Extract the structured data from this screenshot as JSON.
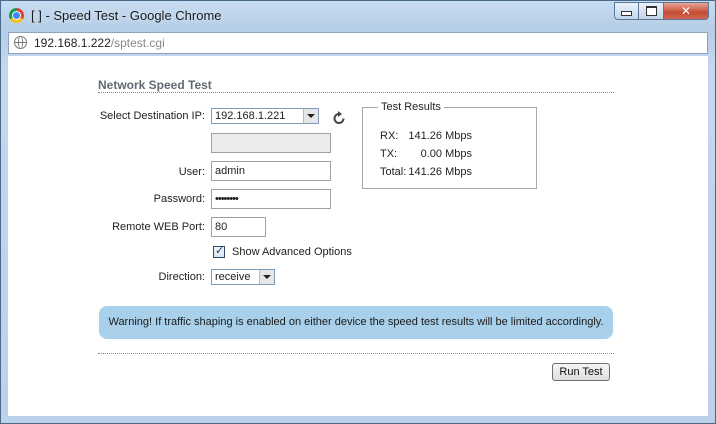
{
  "window": {
    "title": "[ ] - Speed Test - Google Chrome",
    "minimize_icon": "minimize-icon",
    "maximize_icon": "maximize-icon",
    "close_glyph": "✕"
  },
  "address_bar": {
    "host": "192.168.1.222",
    "path": "/sptest.cgi"
  },
  "page": {
    "title": "Network Speed Test",
    "destination": {
      "label": "Select Destination IP:",
      "selected": "192.168.1.221",
      "custom_value": ""
    },
    "user": {
      "label": "User:",
      "value": "admin"
    },
    "password": {
      "label": "Password:",
      "value": "••••••••"
    },
    "remote_port": {
      "label": "Remote WEB Port:",
      "value": "80"
    },
    "advanced": {
      "label": "Show Advanced Options",
      "checked": true
    },
    "direction": {
      "label": "Direction:",
      "selected": "receive"
    },
    "results": {
      "legend": "Test Results",
      "rx_label": "RX:",
      "rx_value": "141.26 Mbps",
      "tx_label": "TX:",
      "tx_value": "0.00 Mbps",
      "total_label": "Total:",
      "total_value": "141.26 Mbps"
    },
    "warning": "Warning! If traffic shaping is enabled on either device the speed test results will be limited accordingly.",
    "run_button": "Run Test"
  },
  "colors": {
    "warning_bg": "#a9d0ea",
    "title_text": "#5f6a74"
  }
}
